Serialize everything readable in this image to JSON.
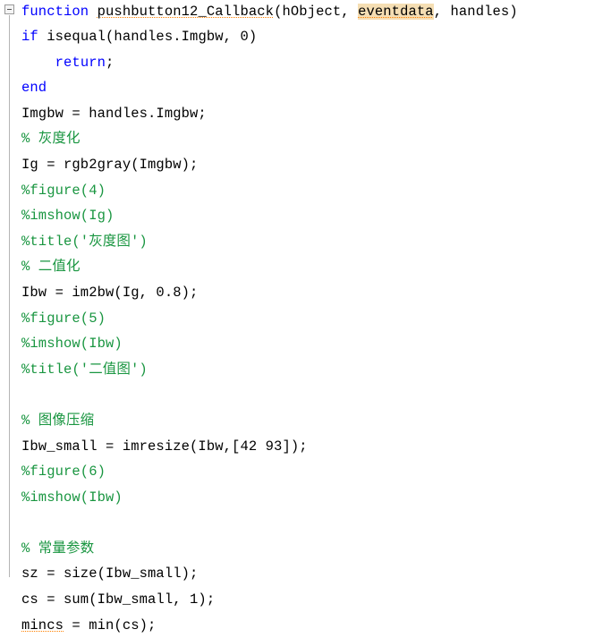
{
  "editor": {
    "language": "matlab",
    "colors": {
      "background": "#ffffff",
      "keyword": "#0000ff",
      "comment": "#1a9641",
      "plain": "#000000",
      "highlight_background": "#f5deb3",
      "squiggle": "#ff8000",
      "guide_line": "#b4b4b4",
      "fold_border": "#999999"
    },
    "fold_marker": {
      "name": "collapse-function-block",
      "state": "expanded",
      "glyph": "−"
    },
    "lines": [
      {
        "n": 1,
        "indent": 0,
        "blank": false,
        "tokens": [
          {
            "t": "function",
            "c": "kw"
          },
          {
            "t": " ",
            "c": "pl"
          },
          {
            "t": "pushbutton12_Callback",
            "c": "pl",
            "squiggle": true
          },
          {
            "t": "(hObject, ",
            "c": "pl"
          },
          {
            "t": "eventdata",
            "c": "pl",
            "highlight": true,
            "squiggle": true
          },
          {
            "t": ", handles)",
            "c": "pl"
          }
        ]
      },
      {
        "n": 2,
        "indent": 0,
        "blank": false,
        "tokens": [
          {
            "t": "if",
            "c": "kw"
          },
          {
            "t": " isequal(handles.Imgbw, 0)",
            "c": "pl"
          }
        ]
      },
      {
        "n": 3,
        "indent": 4,
        "blank": false,
        "tokens": [
          {
            "t": "return",
            "c": "kw"
          },
          {
            "t": ";",
            "c": "pl"
          }
        ]
      },
      {
        "n": 4,
        "indent": 0,
        "blank": false,
        "tokens": [
          {
            "t": "end",
            "c": "kw"
          }
        ]
      },
      {
        "n": 5,
        "indent": 0,
        "blank": false,
        "tokens": [
          {
            "t": "Imgbw = handles.Imgbw;",
            "c": "pl"
          }
        ]
      },
      {
        "n": 6,
        "indent": 0,
        "blank": false,
        "tokens": [
          {
            "t": "% 灰度化",
            "c": "cm"
          }
        ]
      },
      {
        "n": 7,
        "indent": 0,
        "blank": false,
        "tokens": [
          {
            "t": "Ig = rgb2gray(Imgbw);",
            "c": "pl"
          }
        ]
      },
      {
        "n": 8,
        "indent": 0,
        "blank": false,
        "tokens": [
          {
            "t": "%figure(4)",
            "c": "cm"
          }
        ]
      },
      {
        "n": 9,
        "indent": 0,
        "blank": false,
        "tokens": [
          {
            "t": "%imshow(Ig)",
            "c": "cm"
          }
        ]
      },
      {
        "n": 10,
        "indent": 0,
        "blank": false,
        "tokens": [
          {
            "t": "%title('灰度图')",
            "c": "cm"
          }
        ]
      },
      {
        "n": 11,
        "indent": 0,
        "blank": false,
        "tokens": [
          {
            "t": "% 二值化",
            "c": "cm"
          }
        ]
      },
      {
        "n": 12,
        "indent": 0,
        "blank": false,
        "tokens": [
          {
            "t": "Ibw = im2bw(Ig, 0.8);",
            "c": "pl"
          }
        ]
      },
      {
        "n": 13,
        "indent": 0,
        "blank": false,
        "tokens": [
          {
            "t": "%figure(5)",
            "c": "cm"
          }
        ]
      },
      {
        "n": 14,
        "indent": 0,
        "blank": false,
        "tokens": [
          {
            "t": "%imshow(Ibw)",
            "c": "cm"
          }
        ]
      },
      {
        "n": 15,
        "indent": 0,
        "blank": false,
        "tokens": [
          {
            "t": "%title('二值图')",
            "c": "cm"
          }
        ]
      },
      {
        "n": 16,
        "indent": 0,
        "blank": true,
        "tokens": []
      },
      {
        "n": 17,
        "indent": 0,
        "blank": false,
        "tokens": [
          {
            "t": "% 图像压缩",
            "c": "cm"
          }
        ]
      },
      {
        "n": 18,
        "indent": 0,
        "blank": false,
        "tokens": [
          {
            "t": "Ibw_small = imresize(Ibw,[42 93]);",
            "c": "pl"
          }
        ]
      },
      {
        "n": 19,
        "indent": 0,
        "blank": false,
        "tokens": [
          {
            "t": "%figure(6)",
            "c": "cm"
          }
        ]
      },
      {
        "n": 20,
        "indent": 0,
        "blank": false,
        "tokens": [
          {
            "t": "%imshow(Ibw)",
            "c": "cm"
          }
        ]
      },
      {
        "n": 21,
        "indent": 0,
        "blank": true,
        "tokens": []
      },
      {
        "n": 22,
        "indent": 0,
        "blank": false,
        "tokens": [
          {
            "t": "% 常量参数",
            "c": "cm"
          }
        ]
      },
      {
        "n": 23,
        "indent": 0,
        "blank": false,
        "tokens": [
          {
            "t": "sz = size(Ibw_small);",
            "c": "pl"
          }
        ]
      },
      {
        "n": 24,
        "indent": 0,
        "blank": false,
        "tokens": [
          {
            "t": "cs = sum(Ibw_small, 1);",
            "c": "pl"
          }
        ]
      },
      {
        "n": 25,
        "indent": 0,
        "blank": false,
        "tokens": [
          {
            "t": "mincs",
            "c": "pl",
            "squiggle": true
          },
          {
            "t": " = min(cs);",
            "c": "pl"
          }
        ]
      }
    ]
  }
}
